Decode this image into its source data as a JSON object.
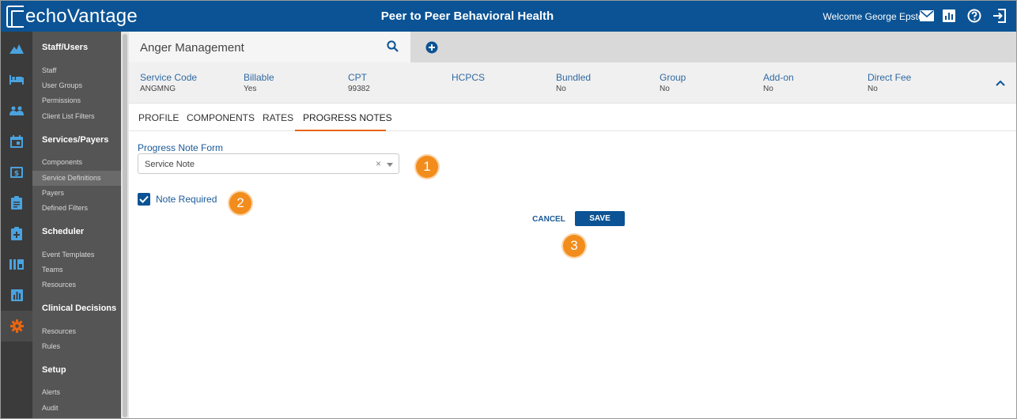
{
  "header": {
    "logo_text": "echoVantage",
    "app_title": "Peer to Peer Behavioral Health",
    "welcome": "Welcome George Epstein",
    "icons": [
      "mail-icon",
      "reports-icon",
      "help-icon",
      "logout-icon"
    ]
  },
  "rail": {
    "icons": [
      "dashboard-icon",
      "bed-icon",
      "people-icon",
      "calendar-icon",
      "billing-icon",
      "clipboard-icon",
      "medical-icon",
      "board-icon",
      "chart-icon",
      "gear-icon"
    ]
  },
  "sidebar": {
    "sections": [
      {
        "title": "Staff/Users",
        "items": [
          "Staff",
          "User Groups",
          "Permissions",
          "Client List Filters"
        ]
      },
      {
        "title": "Services/Payers",
        "items": [
          "Components",
          "Service Definitions",
          "Payers",
          "Defined Filters"
        ]
      },
      {
        "title": "Scheduler",
        "items": [
          "Event Templates",
          "Teams",
          "Resources"
        ]
      },
      {
        "title": "Clinical Decisions",
        "items": [
          "Resources",
          "Rules"
        ]
      },
      {
        "title": "Setup",
        "items": [
          "Alerts",
          "Audit"
        ]
      }
    ]
  },
  "service": {
    "title": "Anger Management",
    "fields": [
      {
        "label": "Service Code",
        "value": "ANGMNG"
      },
      {
        "label": "Billable",
        "value": "Yes"
      },
      {
        "label": "CPT",
        "value": "99382"
      },
      {
        "label": "HCPCS",
        "value": ""
      },
      {
        "label": "Bundled",
        "value": "No"
      },
      {
        "label": "Group",
        "value": "No"
      },
      {
        "label": "Add-on",
        "value": "No"
      },
      {
        "label": "Direct Fee",
        "value": "No"
      }
    ]
  },
  "tabs": [
    "PROFILE",
    "COMPONENTS",
    "RATES",
    "PROGRESS NOTES"
  ],
  "form": {
    "progress_note_label": "Progress Note Form",
    "progress_note_value": "Service Note",
    "clear_glyph": "×",
    "note_required_label": "Note Required",
    "note_required_checked": true,
    "cancel_label": "CANCEL",
    "save_label": "SAVE"
  },
  "callouts": [
    "1",
    "2",
    "3"
  ],
  "colors": {
    "header_blue": "#0b5394",
    "accent_orange": "#e8650f",
    "callout_orange": "#f28c1c"
  }
}
